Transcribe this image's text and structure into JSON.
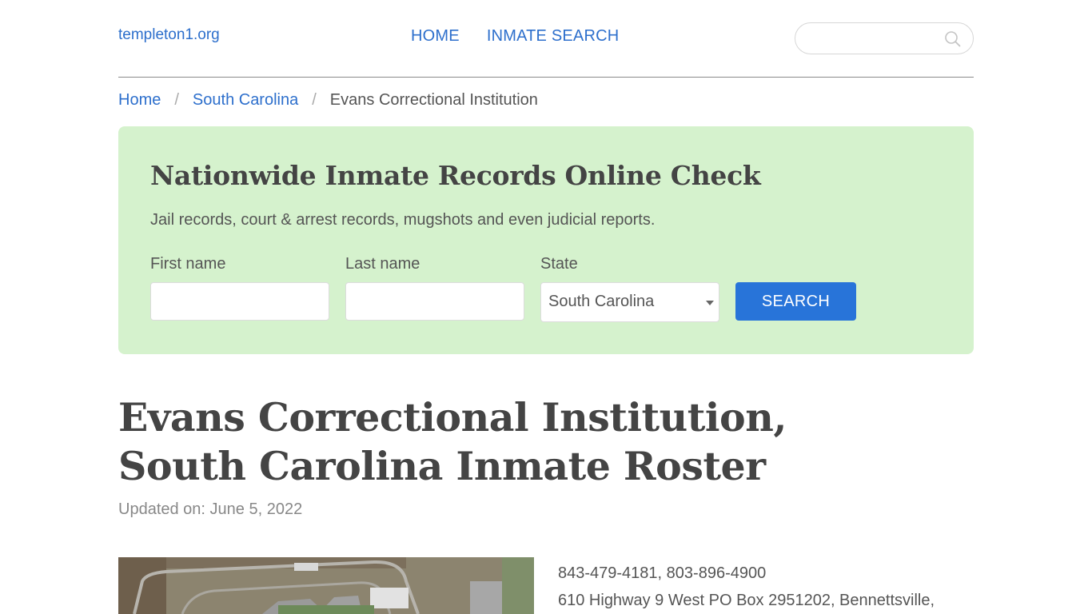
{
  "header": {
    "logo": "templeton1.org",
    "nav": [
      {
        "label": "HOME"
      },
      {
        "label": "INMATE SEARCH"
      }
    ],
    "search": {
      "placeholder": "",
      "value": "",
      "icon": "search-icon"
    }
  },
  "breadcrumb": {
    "items": [
      {
        "label": "Home"
      },
      {
        "label": "South Carolina"
      }
    ],
    "separator": "/",
    "current": "Evans Correctional Institution"
  },
  "promo": {
    "title": "Nationwide Inmate Records Online Check",
    "subtitle": "Jail records, court & arrest records, mugshots and even judicial reports.",
    "first_name": {
      "label": "First name",
      "value": ""
    },
    "last_name": {
      "label": "Last name",
      "value": ""
    },
    "state": {
      "label": "State",
      "value": "South Carolina"
    },
    "button": "SEARCH"
  },
  "main": {
    "title": "Evans Correctional Institution, South Carolina Inmate Roster",
    "updated": "Updated on: June 5, 2022",
    "photo_alt": "Aerial view of Evans Correctional Institution",
    "phones": "843-479-4181, 803-896-4900",
    "address": "610 Highway 9 West PO Box 2951202, Bennettsville,"
  },
  "colors": {
    "link": "#2d6fcc",
    "promo_bg": "#d5f2cd",
    "button": "#2874d9"
  }
}
